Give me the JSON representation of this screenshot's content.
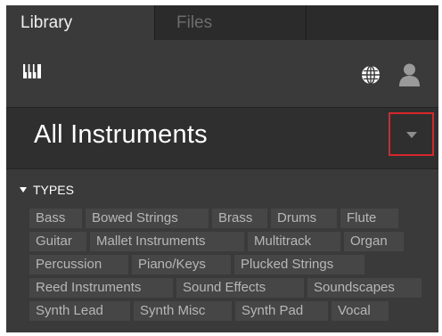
{
  "tabs": {
    "library": "Library",
    "files": "Files"
  },
  "icons": {
    "instruments": "keyboard-icon",
    "web": "globe-icon",
    "user": "user-icon"
  },
  "header": {
    "title": "All Instruments"
  },
  "types": {
    "label": "TYPES",
    "rows": [
      [
        "Bass",
        "Bowed Strings",
        "Brass",
        "Drums",
        "Flute"
      ],
      [
        "Guitar",
        "Mallet Instruments",
        "Multitrack",
        "Organ"
      ],
      [
        "Percussion",
        "Piano/Keys",
        "Plucked Strings"
      ],
      [
        "Reed Instruments",
        "Sound Effects",
        "Soundscapes"
      ],
      [
        "Synth Lead",
        "Synth Misc",
        "Synth Pad",
        "Vocal"
      ]
    ]
  },
  "colors": {
    "panel": "#3a3a3a",
    "tag_bg": "#464646",
    "tag_text": "#b7b7b7",
    "highlight": "#d8262b"
  }
}
